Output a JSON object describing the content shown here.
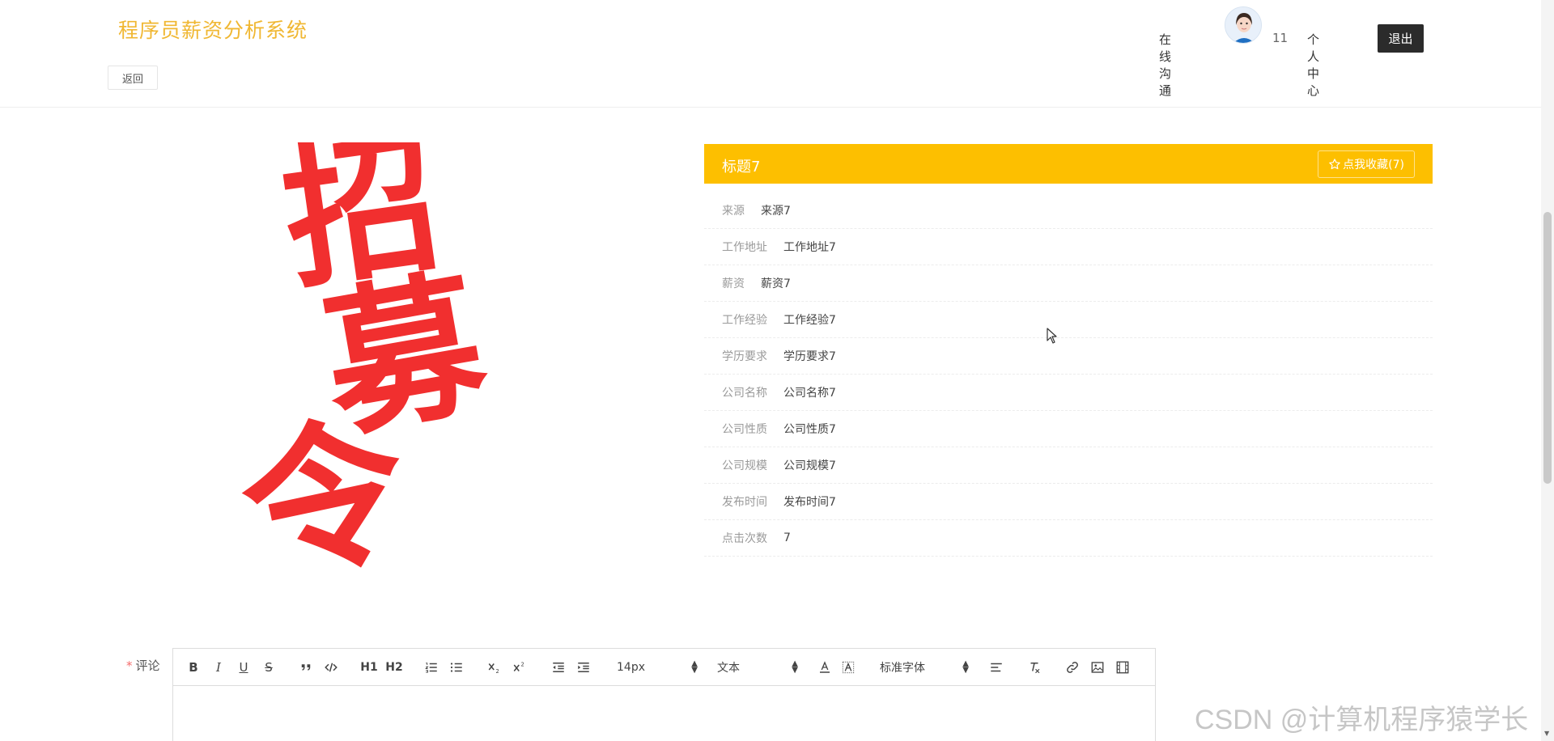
{
  "header": {
    "site_title": "程序员薪资分析系统",
    "back_label": "返回",
    "nav": {
      "chat_label": "在线沟通",
      "user_count": "11",
      "personal_label": "个人中心",
      "logout_label": "退出"
    }
  },
  "poster": {
    "text": "招募令",
    "color": "#f12f2f"
  },
  "detail": {
    "title": "标题7",
    "favorite_label": "点我收藏(7)",
    "header_color": "#fdbf00",
    "rows": [
      {
        "label": "来源",
        "value": "来源7"
      },
      {
        "label": "工作地址",
        "value": "工作地址7"
      },
      {
        "label": "薪资",
        "value": "薪资7"
      },
      {
        "label": "工作经验",
        "value": "工作经验7"
      },
      {
        "label": "学历要求",
        "value": "学历要求7"
      },
      {
        "label": "公司名称",
        "value": "公司名称7"
      },
      {
        "label": "公司性质",
        "value": "公司性质7"
      },
      {
        "label": "公司规模",
        "value": "公司规模7"
      },
      {
        "label": "发布时间",
        "value": "发布时间7"
      },
      {
        "label": "点击次数",
        "value": "7"
      }
    ]
  },
  "comment": {
    "required_mark": "*",
    "label": "评论",
    "toolbar": {
      "bold": "B",
      "italic": "I",
      "underline": "U",
      "strike": "S",
      "h1": "H1",
      "h2": "H2",
      "font_size": "14px",
      "header_select": "文本",
      "font_family": "标准字体"
    }
  },
  "watermark": "CSDN @计算机程序猿学长"
}
